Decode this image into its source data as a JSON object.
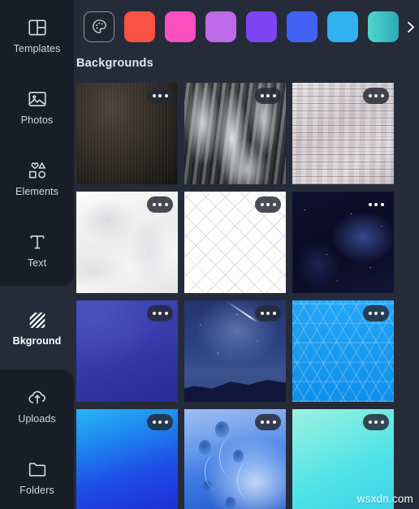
{
  "sidebar": {
    "items": [
      {
        "label": "Templates",
        "icon": "templates-icon",
        "active": false
      },
      {
        "label": "Photos",
        "icon": "photos-icon",
        "active": false
      },
      {
        "label": "Elements",
        "icon": "elements-icon",
        "active": false
      },
      {
        "label": "Text",
        "icon": "text-icon",
        "active": false
      },
      {
        "label": "Bkground",
        "icon": "background-icon",
        "active": true
      },
      {
        "label": "Uploads",
        "icon": "uploads-icon",
        "active": false
      },
      {
        "label": "Folders",
        "icon": "folders-icon",
        "active": false
      }
    ]
  },
  "color_strip": {
    "picker": {
      "icon": "color-palette-icon",
      "label": "Color picker"
    },
    "next": {
      "icon": "chevron-right-icon",
      "label": "More colors"
    },
    "swatches": [
      {
        "name": "red",
        "color": "#f95343"
      },
      {
        "name": "pink",
        "color": "#fa4fbe"
      },
      {
        "name": "orchid",
        "color": "#bd6ae8"
      },
      {
        "name": "violet",
        "color": "#7f45f2"
      },
      {
        "name": "blue",
        "color": "#4263f5"
      },
      {
        "name": "sky",
        "color": "#31b1f0"
      },
      {
        "name": "teal",
        "color": "#4fd6cd"
      }
    ]
  },
  "section": {
    "title": "Backgrounds"
  },
  "grid": {
    "more_label": "More options",
    "tiles": [
      {
        "name": "dark-fabric-texture",
        "art": "art-dark-fabric",
        "more": true,
        "more_bare": false
      },
      {
        "name": "grey-concrete-texture",
        "art": "art-concrete",
        "more": true,
        "more_bare": false
      },
      {
        "name": "white-wood-planks",
        "art": "art-wood",
        "more": true,
        "more_bare": false
      },
      {
        "name": "white-marble-texture",
        "art": "art-marble",
        "more": true,
        "more_bare": false
      },
      {
        "name": "white-lattice-pattern",
        "art": "art-lattice",
        "more": true,
        "more_bare": false
      },
      {
        "name": "deep-space-starfield",
        "art": "art-starfield",
        "more": true,
        "more_bare": true
      },
      {
        "name": "indigo-gradient",
        "art": "art-indigo-grad",
        "more": true,
        "more_bare": false
      },
      {
        "name": "night-sky-meteor",
        "art": "art-night-sky",
        "more": true,
        "more_bare": false
      },
      {
        "name": "blue-honeycomb",
        "art": "art-honeycomb",
        "more": true,
        "more_bare": false
      },
      {
        "name": "blue-gradient",
        "art": "art-blue-grad",
        "more": true,
        "more_bare": false
      },
      {
        "name": "underwater-jellyfish",
        "art": "art-jellyfish",
        "more": true,
        "more_bare": false
      },
      {
        "name": "mint-cyan-gradient",
        "art": "art-mint-grad",
        "more": true,
        "more_bare": false
      }
    ]
  },
  "watermark": {
    "text": "wsxdn.com"
  }
}
